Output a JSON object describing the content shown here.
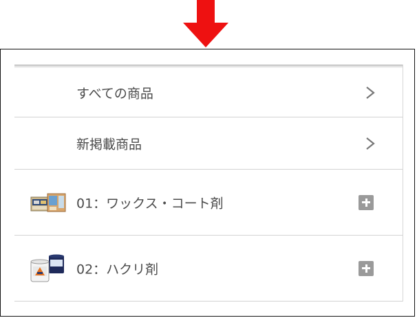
{
  "arrow": {
    "icon": "down-arrow-icon",
    "color": "#ee1111"
  },
  "menu": {
    "items": [
      {
        "label": "すべての商品",
        "action_icon": "chevron-right-icon"
      },
      {
        "label": "新掲載商品",
        "action_icon": "chevron-right-icon"
      },
      {
        "label": "01：ワックス・コート剤",
        "action_icon": "plus-icon",
        "thumbnail": "wax-products-thumbnail"
      },
      {
        "label": "02：ハクリ剤",
        "action_icon": "plus-icon",
        "thumbnail": "stripper-products-thumbnail"
      }
    ]
  }
}
